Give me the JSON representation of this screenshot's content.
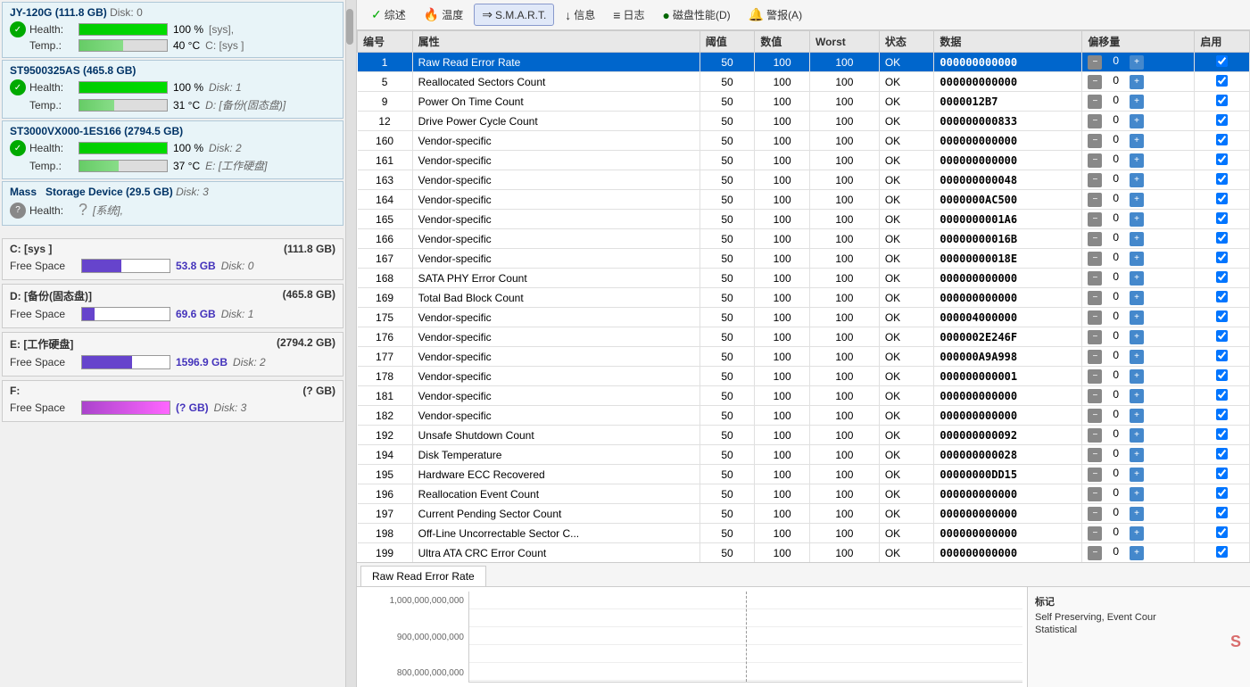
{
  "leftPanel": {
    "disks": [
      {
        "id": "disk0",
        "name": "JY-120G",
        "size": "111.8 GB",
        "diskNum": "Disk: 0",
        "health": 100,
        "healthLabel": "100 %",
        "healthDrive": "[sys],",
        "temp": 40,
        "tempLabel": "40 °C",
        "tempDrive": "C: [sys ]"
      },
      {
        "id": "disk1",
        "name": "ST9500325AS",
        "size": "465.8 GB",
        "diskNum": "",
        "health": 100,
        "healthLabel": "100 %",
        "healthDrive": "Disk: 1",
        "temp": 31,
        "tempLabel": "31 °C",
        "tempDrive": "D: [备份(固态盘)]"
      },
      {
        "id": "disk2",
        "name": "ST3000VX000-1ES166",
        "size": "2794.5 GB",
        "diskNum": "",
        "health": 100,
        "healthLabel": "100 %",
        "healthDrive": "Disk: 2",
        "temp": 37,
        "tempLabel": "37 °C",
        "tempDrive": "E: [工作硬盘]"
      }
    ],
    "massDisk": {
      "name": "Mass  Storage Device",
      "size": "29.5 GB",
      "diskNum": "Disk: 3",
      "health": "?",
      "healthDrive": "[系统],"
    },
    "drives": [
      {
        "letter": "C: [sys ]",
        "total": "111.8 GB",
        "freeSpace": "53.8 GB",
        "diskNum": "Disk: 0",
        "barWidth": 45
      },
      {
        "letter": "D: [备份(固态盘)]",
        "total": "465.8 GB",
        "freeSpace": "69.6 GB",
        "diskNum": "Disk: 1",
        "barWidth": 14
      },
      {
        "letter": "E: [工作硬盘]",
        "total": "2794.2 GB",
        "freeSpace": "1596.9 GB",
        "diskNum": "Disk: 2",
        "barWidth": 57
      },
      {
        "letter": "F:",
        "total": "? GB",
        "freeSpace": "? GB",
        "diskNum": "Disk: 3",
        "barWidth": 100
      }
    ]
  },
  "toolbar": {
    "tabs": [
      {
        "icon": "✓",
        "label": "综述"
      },
      {
        "icon": "🔥",
        "label": "温度"
      },
      {
        "icon": "→",
        "label": "S.M.A.R.T."
      },
      {
        "icon": "↓",
        "label": "信息"
      },
      {
        "icon": "≡",
        "label": "日志"
      },
      {
        "icon": "●",
        "label": "磁盘性能(D)"
      },
      {
        "icon": "🔔",
        "label": "警报(A)"
      }
    ]
  },
  "table": {
    "headers": [
      "编号",
      "属性",
      "阈值",
      "数值",
      "Worst",
      "状态",
      "数据",
      "偏移量",
      "启用"
    ],
    "rows": [
      {
        "id": 1,
        "attr": "Raw Read Error Rate",
        "threshold": 50,
        "value": 100,
        "worst": 100,
        "status": "OK",
        "data": "000000000000",
        "offset": 0,
        "enabled": true,
        "selected": true
      },
      {
        "id": 5,
        "attr": "Reallocated Sectors Count",
        "threshold": 50,
        "value": 100,
        "worst": 100,
        "status": "OK",
        "data": "000000000000",
        "offset": 0,
        "enabled": true,
        "selected": false
      },
      {
        "id": 9,
        "attr": "Power On Time Count",
        "threshold": 50,
        "value": 100,
        "worst": 100,
        "status": "OK",
        "data": "0000012B7",
        "offset": 0,
        "enabled": true,
        "selected": false
      },
      {
        "id": 12,
        "attr": "Drive Power Cycle Count",
        "threshold": 50,
        "value": 100,
        "worst": 100,
        "status": "OK",
        "data": "000000000833",
        "offset": 0,
        "enabled": true,
        "selected": false
      },
      {
        "id": 160,
        "attr": "Vendor-specific",
        "threshold": 50,
        "value": 100,
        "worst": 100,
        "status": "OK",
        "data": "000000000000",
        "offset": 0,
        "enabled": true,
        "selected": false
      },
      {
        "id": 161,
        "attr": "Vendor-specific",
        "threshold": 50,
        "value": 100,
        "worst": 100,
        "status": "OK",
        "data": "000000000000",
        "offset": 0,
        "enabled": true,
        "selected": false
      },
      {
        "id": 163,
        "attr": "Vendor-specific",
        "threshold": 50,
        "value": 100,
        "worst": 100,
        "status": "OK",
        "data": "000000000048",
        "offset": 0,
        "enabled": true,
        "selected": false
      },
      {
        "id": 164,
        "attr": "Vendor-specific",
        "threshold": 50,
        "value": 100,
        "worst": 100,
        "status": "OK",
        "data": "0000000AC500",
        "offset": 0,
        "enabled": true,
        "selected": false
      },
      {
        "id": 165,
        "attr": "Vendor-specific",
        "threshold": 50,
        "value": 100,
        "worst": 100,
        "status": "OK",
        "data": "0000000001A6",
        "offset": 0,
        "enabled": true,
        "selected": false
      },
      {
        "id": 166,
        "attr": "Vendor-specific",
        "threshold": 50,
        "value": 100,
        "worst": 100,
        "status": "OK",
        "data": "00000000016B",
        "offset": 0,
        "enabled": true,
        "selected": false
      },
      {
        "id": 167,
        "attr": "Vendor-specific",
        "threshold": 50,
        "value": 100,
        "worst": 100,
        "status": "OK",
        "data": "00000000018E",
        "offset": 0,
        "enabled": true,
        "selected": false
      },
      {
        "id": 168,
        "attr": "SATA PHY Error Count",
        "threshold": 50,
        "value": 100,
        "worst": 100,
        "status": "OK",
        "data": "000000000000",
        "offset": 0,
        "enabled": true,
        "selected": false
      },
      {
        "id": 169,
        "attr": "Total Bad Block Count",
        "threshold": 50,
        "value": 100,
        "worst": 100,
        "status": "OK",
        "data": "000000000000",
        "offset": 0,
        "enabled": true,
        "selected": false
      },
      {
        "id": 175,
        "attr": "Vendor-specific",
        "threshold": 50,
        "value": 100,
        "worst": 100,
        "status": "OK",
        "data": "000004000000",
        "offset": 0,
        "enabled": true,
        "selected": false
      },
      {
        "id": 176,
        "attr": "Vendor-specific",
        "threshold": 50,
        "value": 100,
        "worst": 100,
        "status": "OK",
        "data": "0000002E246F",
        "offset": 0,
        "enabled": true,
        "selected": false
      },
      {
        "id": 177,
        "attr": "Vendor-specific",
        "threshold": 50,
        "value": 100,
        "worst": 100,
        "status": "OK",
        "data": "000000A9A998",
        "offset": 0,
        "enabled": true,
        "selected": false
      },
      {
        "id": 178,
        "attr": "Vendor-specific",
        "threshold": 50,
        "value": 100,
        "worst": 100,
        "status": "OK",
        "data": "000000000001",
        "offset": 0,
        "enabled": true,
        "selected": false
      },
      {
        "id": 181,
        "attr": "Vendor-specific",
        "threshold": 50,
        "value": 100,
        "worst": 100,
        "status": "OK",
        "data": "000000000000",
        "offset": 0,
        "enabled": true,
        "selected": false
      },
      {
        "id": 182,
        "attr": "Vendor-specific",
        "threshold": 50,
        "value": 100,
        "worst": 100,
        "status": "OK",
        "data": "000000000000",
        "offset": 0,
        "enabled": true,
        "selected": false
      },
      {
        "id": 192,
        "attr": "Unsafe Shutdown Count",
        "threshold": 50,
        "value": 100,
        "worst": 100,
        "status": "OK",
        "data": "000000000092",
        "offset": 0,
        "enabled": true,
        "selected": false
      },
      {
        "id": 194,
        "attr": "Disk Temperature",
        "threshold": 50,
        "value": 100,
        "worst": 100,
        "status": "OK",
        "data": "000000000028",
        "offset": 0,
        "enabled": true,
        "selected": false
      },
      {
        "id": 195,
        "attr": "Hardware ECC Recovered",
        "threshold": 50,
        "value": 100,
        "worst": 100,
        "status": "OK",
        "data": "00000000DD15",
        "offset": 0,
        "enabled": true,
        "selected": false
      },
      {
        "id": 196,
        "attr": "Reallocation Event Count",
        "threshold": 50,
        "value": 100,
        "worst": 100,
        "status": "OK",
        "data": "000000000000",
        "offset": 0,
        "enabled": true,
        "selected": false
      },
      {
        "id": 197,
        "attr": "Current Pending Sector Count",
        "threshold": 50,
        "value": 100,
        "worst": 100,
        "status": "OK",
        "data": "000000000000",
        "offset": 0,
        "enabled": true,
        "selected": false
      },
      {
        "id": 198,
        "attr": "Off-Line Uncorrectable Sector C...",
        "threshold": 50,
        "value": 100,
        "worst": 100,
        "status": "OK",
        "data": "000000000000",
        "offset": 0,
        "enabled": true,
        "selected": false
      },
      {
        "id": 199,
        "attr": "Ultra ATA CRC Error Count",
        "threshold": 50,
        "value": 100,
        "worst": 100,
        "status": "OK",
        "data": "000000000000",
        "offset": 0,
        "enabled": true,
        "selected": false
      }
    ]
  },
  "bottomSection": {
    "activeTab": "Raw Read Error Rate",
    "chartYLabels": [
      "1,000,000,000,000",
      "900,000,000,000",
      "800,000,000,000"
    ],
    "legend": {
      "title": "标记",
      "items": [
        "Self Preserving, Event Cour",
        "Statistical"
      ]
    }
  }
}
